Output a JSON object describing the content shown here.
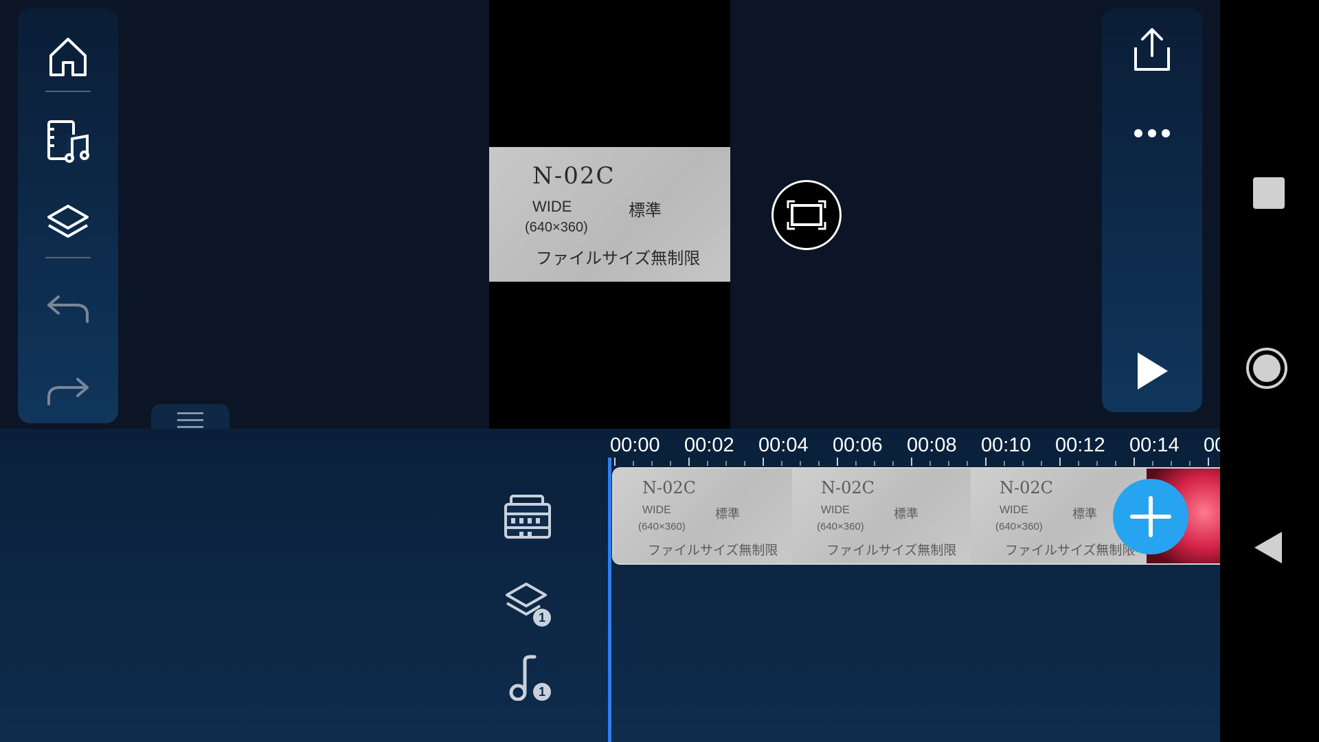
{
  "preview": {
    "image_text": {
      "line1": "N-02C",
      "line2_left": "WIDE",
      "line2_right": "標準",
      "line3": "(640×360)",
      "line4": "ファイルサイズ無制限"
    }
  },
  "left_toolbar": {
    "items": [
      {
        "icon": "home-icon"
      },
      {
        "icon": "media-library-icon"
      },
      {
        "icon": "layers-icon"
      },
      {
        "icon": "undo-icon"
      },
      {
        "icon": "redo-icon"
      }
    ]
  },
  "right_toolbar": {
    "items": [
      {
        "icon": "share-icon"
      },
      {
        "icon": "more-icon"
      },
      {
        "icon": "play-icon"
      }
    ]
  },
  "timeline": {
    "ruler_labels": [
      "00:00",
      "00:02",
      "00:04",
      "00:06",
      "00:08",
      "00:10",
      "00:12",
      "00:14",
      "00:"
    ],
    "tracks": [
      {
        "icon": "video-track-icon"
      },
      {
        "icon": "layer-track-icon",
        "badge": "1"
      },
      {
        "icon": "audio-track-icon",
        "badge": "1"
      }
    ],
    "clip_thumb": {
      "line1": "N-02C",
      "line2_left": "WIDE",
      "line2_right": "標準",
      "line3": "(640×360)",
      "line4": "ファイルサイズ無制限"
    }
  },
  "colors": {
    "accent": "#27a4ef",
    "playhead": "#2d7ff0",
    "panel": "#0f2c4d"
  }
}
